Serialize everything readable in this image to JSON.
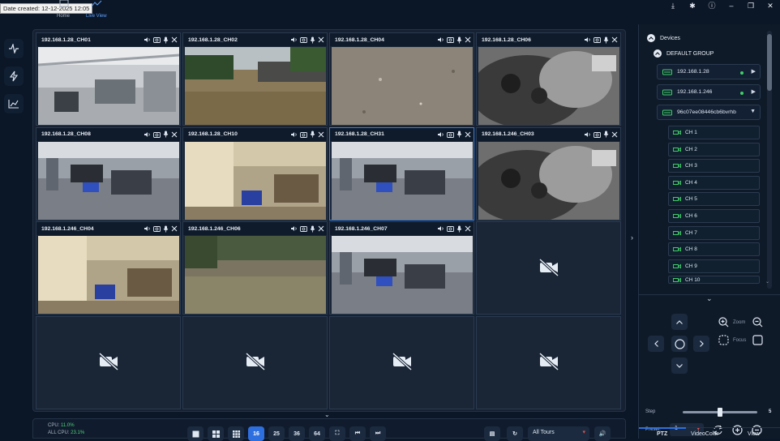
{
  "app": {
    "date_created": "Date created: 12-12-2025 12:05",
    "nav": [
      {
        "label": "Home"
      },
      {
        "label": "Live View"
      }
    ]
  },
  "grid": {
    "tiles": [
      {
        "name": "192.168.1.28_CH01",
        "scene": "office-wide"
      },
      {
        "name": "192.168.1.28_CH02",
        "scene": "yard"
      },
      {
        "name": "192.168.1.28_CH04",
        "scene": "ground"
      },
      {
        "name": "192.168.1.28_CH06",
        "scene": "mono-closeup"
      },
      {
        "name": "192.168.1.28_CH08",
        "scene": "office"
      },
      {
        "name": "192.168.1.28_CH10",
        "scene": "office-warm"
      },
      {
        "name": "192.168.1.28_CH31",
        "scene": "office",
        "selected": true
      },
      {
        "name": "192.168.1.246_CH03",
        "scene": "mono-closeup"
      },
      {
        "name": "192.168.1.246_CH04",
        "scene": "office-warm"
      },
      {
        "name": "192.168.1.246_CH06",
        "scene": "yard-grass"
      },
      {
        "name": "192.168.1.246_CH07",
        "scene": "office"
      },
      {
        "name": "",
        "scene": "empty"
      },
      {
        "name": "",
        "scene": "empty"
      },
      {
        "name": "",
        "scene": "empty"
      },
      {
        "name": "",
        "scene": "empty"
      },
      {
        "name": "",
        "scene": "empty"
      }
    ]
  },
  "bottombar": {
    "cpu_label": "CPU:",
    "cpu_value": "11.0%",
    "all_cpu_label": "ALL CPU:",
    "all_cpu_value": "23.1%",
    "layout_buttons": [
      "16",
      "25",
      "36",
      "64"
    ],
    "active_layout": "16",
    "tours": "All Tours"
  },
  "devices": {
    "title": "Devices",
    "group": "DEFAULT GROUP",
    "items": [
      {
        "label": "192.168.1.28",
        "online": true
      },
      {
        "label": "192.168.1.246",
        "online": true
      },
      {
        "label": "96c07ee08446cb6bvrhb",
        "online": false
      }
    ],
    "channels": [
      "CH 1",
      "CH 2",
      "CH 3",
      "CH 4",
      "CH 5",
      "CH 6",
      "CH 7",
      "CH 8",
      "CH 9",
      "CH 10"
    ]
  },
  "ptz": {
    "zoom_label": "Zoom",
    "focus_label": "Focus",
    "step_label": "Step",
    "step_value": "5",
    "preset_label": "Preset:",
    "preset_value": "1",
    "tabs": [
      "PTZ",
      "VideoColor",
      "View"
    ]
  },
  "colors": {
    "accent": "#2e6fe0",
    "online": "#40d068",
    "cpu": "#4fd17a"
  }
}
